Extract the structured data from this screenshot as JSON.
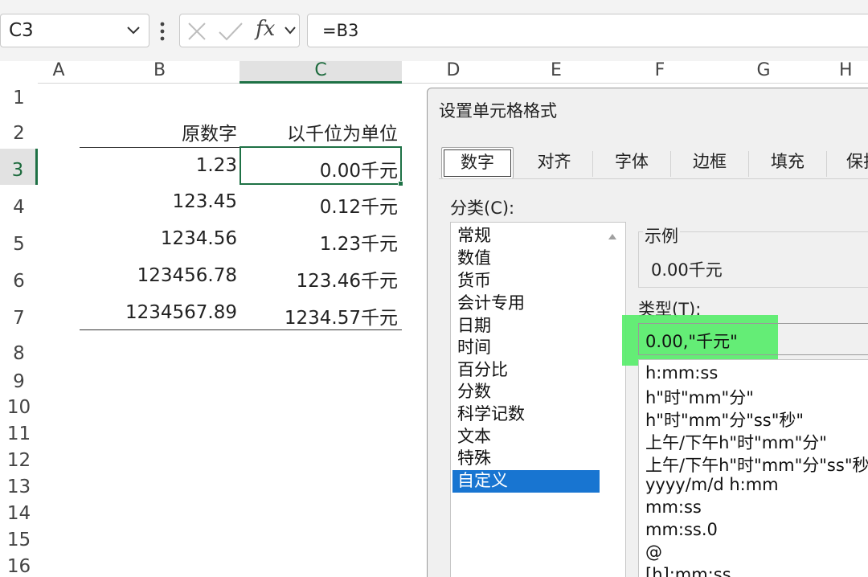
{
  "formula_bar": {
    "name_box": "C3",
    "fx": "fx",
    "formula": "=B3"
  },
  "columns": [
    "A",
    "B",
    "C",
    "D",
    "E",
    "F",
    "G",
    "H"
  ],
  "rows": [
    "1",
    "2",
    "3",
    "4",
    "5",
    "6",
    "7",
    "8",
    "9",
    "10",
    "11",
    "12",
    "13",
    "14",
    "15",
    "16"
  ],
  "table": {
    "headers": [
      "原数字",
      "以千位为单位"
    ],
    "rows": [
      [
        "1.23",
        "0.00千元"
      ],
      [
        "123.45",
        "0.12千元"
      ],
      [
        "1234.56",
        "1.23千元"
      ],
      [
        "123456.78",
        "123.46千元"
      ],
      [
        "1234567.89",
        "1234.57千元"
      ]
    ]
  },
  "dialog": {
    "title": "设置单元格格式",
    "tabs": [
      "数字",
      "对齐",
      "字体",
      "边框",
      "填充",
      "保护"
    ],
    "category_label": "分类(C):",
    "categories": [
      "常规",
      "数值",
      "货币",
      "会计专用",
      "日期",
      "时间",
      "百分比",
      "分数",
      "科学记数",
      "文本",
      "特殊",
      "自定义"
    ],
    "selected_category": "自定义",
    "sample_label": "示例",
    "sample_value": "0.00千元",
    "type_label": "类型(T):",
    "type_value": "0.00,\"千元\"",
    "type_list": [
      "h:mm:ss",
      "h\"时\"mm\"分\"",
      "h\"时\"mm\"分\"ss\"秒\"",
      "上午/下午h\"时\"mm\"分\"",
      "上午/下午h\"时\"mm\"分\"ss\"秒\"",
      "yyyy/m/d h:mm",
      "mm:ss",
      "mm:ss.0",
      "@",
      "[h]:mm:ss"
    ]
  },
  "colors": {
    "excel_green": "#1e7145",
    "selection_blue": "#1875d1",
    "highlight_green": "#58ed6b"
  }
}
